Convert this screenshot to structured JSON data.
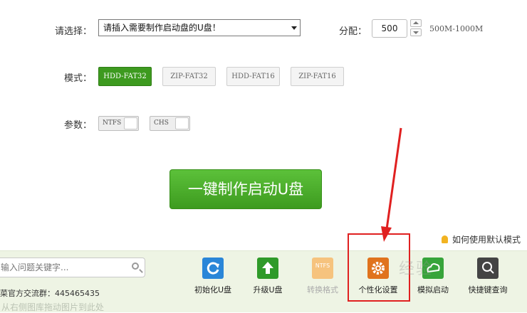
{
  "form": {
    "select_label": "请选择：",
    "select_value": "请插入需要制作启动盘的U盘！",
    "alloc_label": "分配：",
    "alloc_value": "500",
    "alloc_range": "500M-1000M",
    "mode_label": "模式：",
    "modes": [
      {
        "label": "HDD-FAT32",
        "active": true
      },
      {
        "label": "ZIP-FAT32",
        "active": false
      },
      {
        "label": "HDD-FAT16",
        "active": false
      },
      {
        "label": "ZIP-FAT16",
        "active": false
      }
    ],
    "param_label": "参数：",
    "params": [
      "NTFS",
      "CHS"
    ]
  },
  "main_button": "一键制作启动U盘",
  "help_link": "如何使用默认模式",
  "bottom": {
    "search_placeholder": "输入问题关键字...",
    "qq_text": "菜官方交流群：445465435",
    "faded_text": "从右侧图库拖动图片到此处",
    "tools": [
      {
        "label": "初始化U盘",
        "icon": "refresh-icon",
        "color": "#2a86d8"
      },
      {
        "label": "升级U盘",
        "icon": "upload-arrow-icon",
        "color": "#2f9a29"
      },
      {
        "label": "转换格式",
        "icon": "ntfs-icon",
        "color": "#f6c37e"
      },
      {
        "label": "个性化设置",
        "icon": "gear-icon",
        "color": "#e0731d"
      },
      {
        "label": "模拟启动",
        "icon": "cloud-icon",
        "color": "#37a43a"
      },
      {
        "label": "快捷键查询",
        "icon": "search-icon",
        "color": "#444444"
      }
    ]
  },
  "watermark": "经验"
}
